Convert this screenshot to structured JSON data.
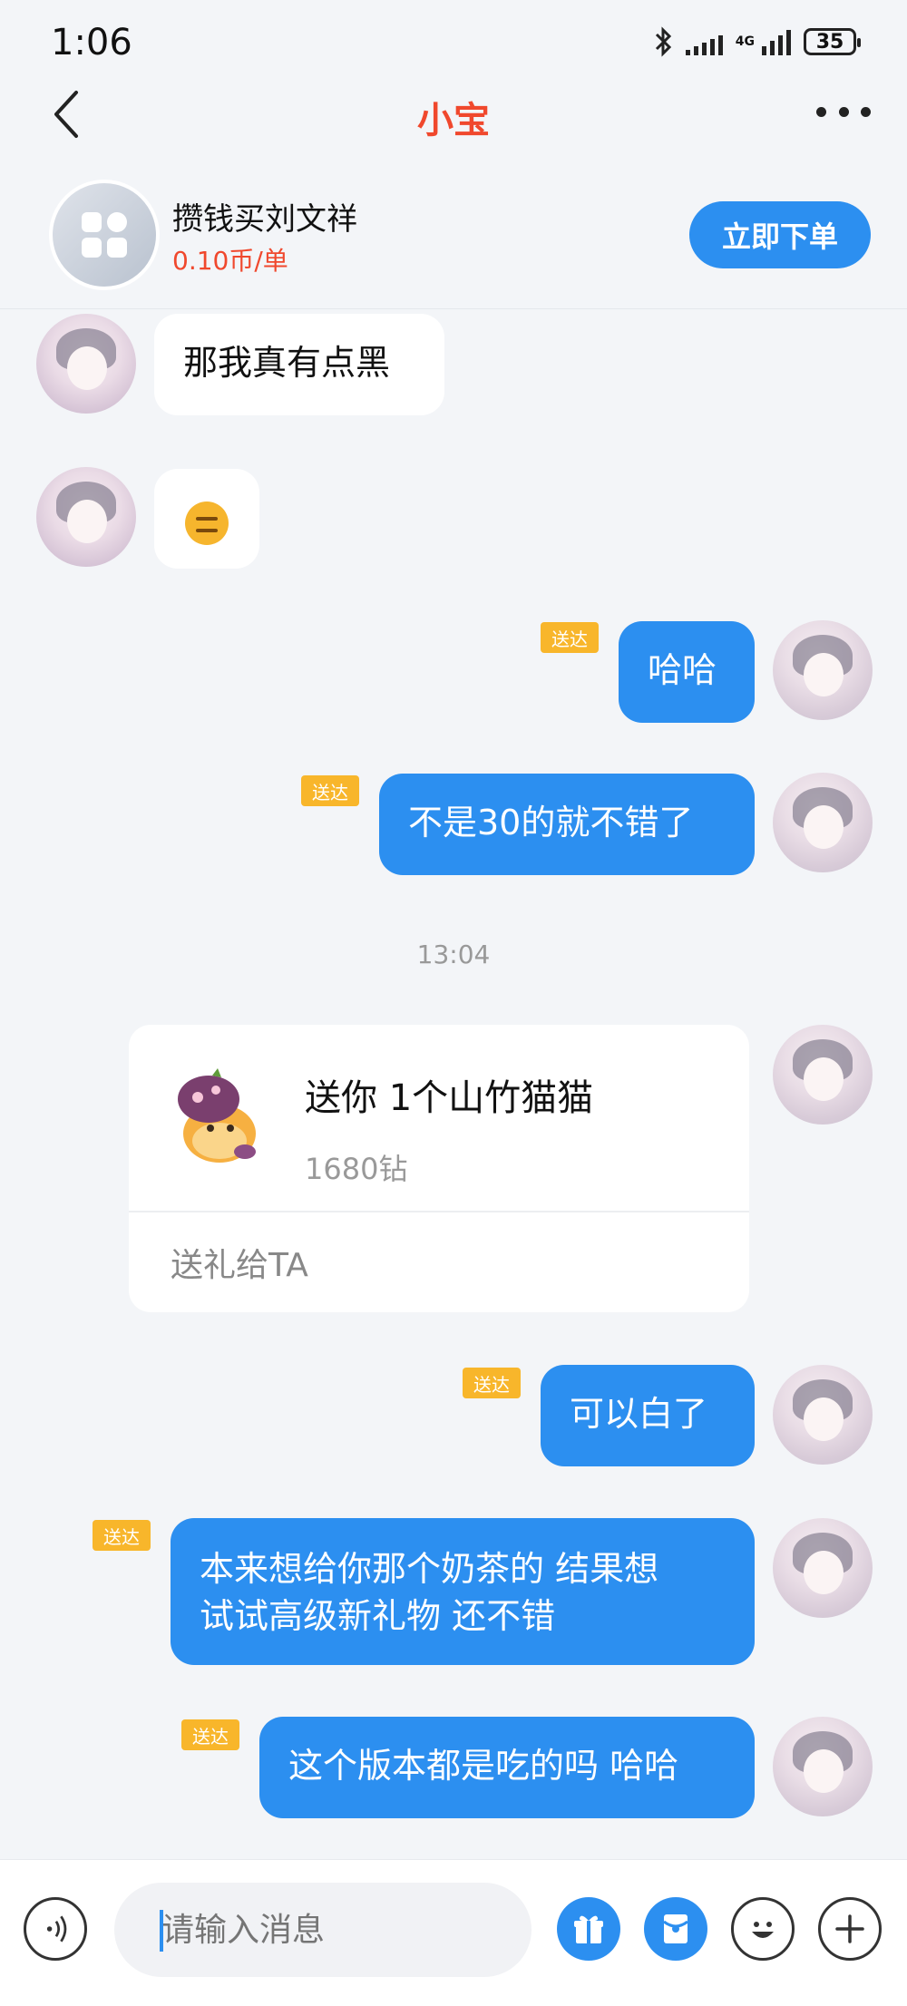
{
  "status_bar": {
    "time": "1:06",
    "network": "4G",
    "battery": "35"
  },
  "header": {
    "title": "小宝"
  },
  "service": {
    "name": "攒钱买刘文祥",
    "price": "0.10币/单",
    "order_label": "立即下单"
  },
  "messages": {
    "m1": "那我真有点黑",
    "m3": "哈哈",
    "m4": "不是30的就不错了",
    "m5": "可以白了",
    "m6_line1": "本来想给你那个奶茶的 结果想",
    "m6_line2": "试试高级新礼物 还不错",
    "m7": "这个版本都是吃的吗 哈哈"
  },
  "delivered_label": "送达",
  "time_separator": "13:04",
  "gift": {
    "title": "送你 1个山竹猫猫",
    "price": "1680钻",
    "action_label": "送礼给TA"
  },
  "input": {
    "placeholder": "请输入消息"
  },
  "colors": {
    "accent_blue": "#2c8ff0",
    "title_red": "#f0482d",
    "tag_yellow": "#f8b62b"
  }
}
